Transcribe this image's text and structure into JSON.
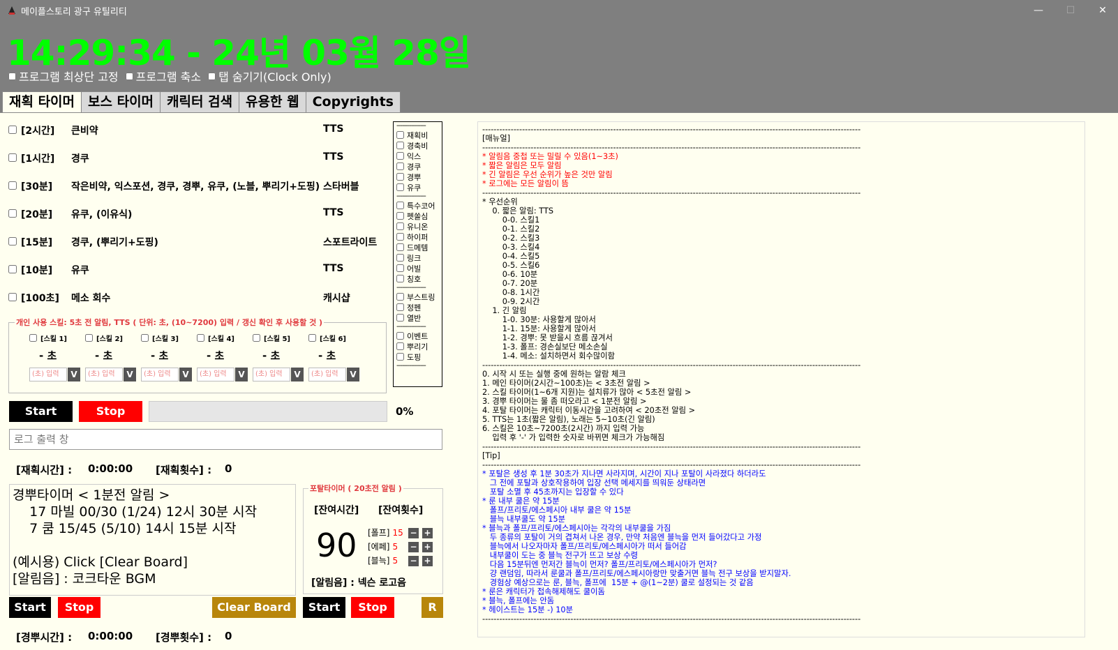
{
  "window": {
    "title": "메이플스토리 광구 유틸리티",
    "minimize": "—",
    "maximize": "☐",
    "close": "✕"
  },
  "clock": "14:29:34 - 24년 03월 28일",
  "options": [
    "프로그램 최상단 고정",
    "프로그램 축소",
    "탭 숨기기(Clock Only)"
  ],
  "tabs": [
    "재획 타이머",
    "보스 타이머",
    "캐릭터 검색",
    "유용한 웹",
    "Copyrights"
  ],
  "timers": [
    {
      "time": "[2시간]",
      "items": "큰비약",
      "sound": "TTS"
    },
    {
      "time": "[1시간]",
      "items": "경쿠",
      "sound": "TTS"
    },
    {
      "time": "[30분]",
      "items": "작은비약, 익스포션, 경쿠, 경뿌, 유쿠, (노블, 뿌리기+도핑)",
      "sound": "스타버블"
    },
    {
      "time": "[20분]",
      "items": "유쿠, (이유식)",
      "sound": "TTS"
    },
    {
      "time": "[15분]",
      "items": "경쿠, (뿌리기+도핑)",
      "sound": "스포트라이트"
    },
    {
      "time": "[10분]",
      "items": "유쿠",
      "sound": "TTS"
    },
    {
      "time": "[100초]",
      "items": "메소 회수",
      "sound": "캐시샵"
    }
  ],
  "checklist": {
    "dash": "----------------",
    "groups": [
      [
        "재획비",
        "경축비",
        "익스",
        "경쿠",
        "경뿌",
        "유쿠"
      ],
      [
        "특수코어",
        "펫쏠심",
        "유니온",
        "하이퍼",
        "드메템",
        "링크",
        "어빌",
        "칭호"
      ],
      [
        "부스트링",
        "정펜",
        "열반"
      ],
      [
        "이벤트",
        "뿌리기",
        "도핑"
      ]
    ]
  },
  "skills": {
    "legend": "개인 사용 스킬: 5초 전 알림, TTS ( 단위: 초, (10~7200) 입력 / 갱신 확인 후 사용할 것 )",
    "items": [
      {
        "label": "[스킬 1]",
        "value": "-  초",
        "placeholder": "(초) 입력",
        "button": "V"
      },
      {
        "label": "[스킬 2]",
        "value": "-  초",
        "placeholder": "(초) 입력",
        "button": "V"
      },
      {
        "label": "[스킬 3]",
        "value": "-  초",
        "placeholder": "(초) 입력",
        "button": "V"
      },
      {
        "label": "[스킬 4]",
        "value": "-  초",
        "placeholder": "(초) 입력",
        "button": "V"
      },
      {
        "label": "[스킬 5]",
        "value": "-  초",
        "placeholder": "(초) 입력",
        "button": "V"
      },
      {
        "label": "[스킬 6]",
        "value": "-  초",
        "placeholder": "(초) 입력",
        "button": "V"
      }
    ]
  },
  "controls": {
    "start": "Start",
    "stop": "Stop",
    "progress": 0,
    "percent": "0%",
    "log_placeholder": "로그 출력 창"
  },
  "stats": {
    "hunt_time_label": "[재획시간] :",
    "hunt_time": "0:00:00",
    "hunt_count_label": "[재획횟수] :",
    "hunt_count": "0",
    "gb_time_label": "[경뿌시간] :",
    "gb_time": "0:00:00",
    "gb_count_label": "[경뿌횟수] :",
    "gb_count": "0"
  },
  "board": {
    "text": "경뿌타이머 < 1분전 알림 >\n    17 마빌 00/30 (1/24) 12시 30분 시작\n    7 쿰 15/45 (5/10) 14시 15분 시작\n\n(예시용) Click [Clear Board]\n[알림음] : 코크타운 BGM",
    "start": "Start",
    "stop": "Stop",
    "clear": "Clear Board"
  },
  "portal": {
    "legend": "포탈타이머 ( 20초전 알림 )",
    "remain_time_label": "[잔여시간]",
    "remain_count_label": "[잔여횟수]",
    "time": "90",
    "counters": [
      {
        "label": "[폴프]",
        "value": "15"
      },
      {
        "label": "[에페]",
        "value": "5"
      },
      {
        "label": "[블늑]",
        "value": "5"
      }
    ],
    "minus": "−",
    "plus": "+",
    "sound": "[알림음] : 넥슨 로고음",
    "start": "Start",
    "stop": "Stop",
    "reset": "R"
  },
  "manual": [
    {
      "c": "",
      "t": "-------------------------------------------------------------------------------------------------------------------------------------"
    },
    {
      "c": "",
      "t": "[매뉴얼]"
    },
    {
      "c": "",
      "t": "-------------------------------------------------------------------------------------------------------------------------------------"
    },
    {
      "c": "red",
      "t": "* 알림음 중첩 또는 밀릴 수 있음(1~3초)"
    },
    {
      "c": "red",
      "t": "* 짧은 알림은 모두 알림"
    },
    {
      "c": "red",
      "t": "* 긴 알림은 우선 순위가 높은 것만 알림"
    },
    {
      "c": "red",
      "t": "* 로그에는 모든 알림이 뜸"
    },
    {
      "c": "",
      "t": "-------------------------------------------------------------------------------------------------------------------------------------"
    },
    {
      "c": "",
      "t": "* 우선순위"
    },
    {
      "c": "",
      "t": "    0. 짧은 알림: TTS"
    },
    {
      "c": "",
      "t": "        0-0. 스킬1"
    },
    {
      "c": "",
      "t": "        0-1. 스킬2"
    },
    {
      "c": "",
      "t": "        0-2. 스킬3"
    },
    {
      "c": "",
      "t": "        0-3. 스킬4"
    },
    {
      "c": "",
      "t": "        0-4. 스킬5"
    },
    {
      "c": "",
      "t": "        0-5. 스킬6"
    },
    {
      "c": "",
      "t": "        0-6. 10분"
    },
    {
      "c": "",
      "t": "        0-7. 20분"
    },
    {
      "c": "",
      "t": "        0-8. 1시간"
    },
    {
      "c": "",
      "t": "        0-9. 2시간"
    },
    {
      "c": "",
      "t": "    1. 긴 알림"
    },
    {
      "c": "",
      "t": "        1-0. 30분: 사용할게 많아서"
    },
    {
      "c": "",
      "t": "        1-1. 15분: 사용할게 많아서"
    },
    {
      "c": "",
      "t": "        1-2. 경뿌: 못 받을시 흐름 끊겨서"
    },
    {
      "c": "",
      "t": "        1-3. 폴프: 경손실보단 메소손실"
    },
    {
      "c": "",
      "t": "        1-4. 메소: 설치하면서 회수많이함"
    },
    {
      "c": "",
      "t": "-------------------------------------------------------------------------------------------------------------------------------------"
    },
    {
      "c": "",
      "t": "0. 시작 시 또는 실행 중에 원하는 알람 체크"
    },
    {
      "c": "",
      "t": "1. 메인 타이머(2시간~100초)는 < 3초전 알림 >"
    },
    {
      "c": "",
      "t": "2. 스킬 타이머(1~6개 지원)는 설치류가 많아 < 5초전 알림 >"
    },
    {
      "c": "",
      "t": "3. 경뿌 타이머는 물 좀 떠오라고 < 1분전 알림 >"
    },
    {
      "c": "",
      "t": "4. 포탈 타이머는 캐릭터 이동시간을 고려하여 < 20초전 알림 >"
    },
    {
      "c": "",
      "t": "5. TTS는 1초(짧은 알림), 노래는 5~10초(긴 알림)"
    },
    {
      "c": "",
      "t": "6. 스킬은 10초~7200초(2시간) 까지 입력 가능"
    },
    {
      "c": "",
      "t": "    입력 후 '-' 가 입력한 숫자로 바뀌면 체크가 가능해짐"
    },
    {
      "c": "",
      "t": "-------------------------------------------------------------------------------------------------------------------------------------"
    },
    {
      "c": "",
      "t": "[Tip]"
    },
    {
      "c": "",
      "t": "-------------------------------------------------------------------------------------------------------------------------------------"
    },
    {
      "c": "blue",
      "t": "* 포탈은 생성 후 1분 30초가 지나면 사라지며, 시간이 지나 포탈이 사라졌다 하더라도"
    },
    {
      "c": "blue",
      "t": "   그 전에 포탈과 상호작용하여 입장 선택 메세지를 띄워둔 상태라면"
    },
    {
      "c": "blue",
      "t": "   포탈 소멸 후 45초까지는 입장할 수 있다"
    },
    {
      "c": "blue",
      "t": "* 룬 내부 쿨은 약 15분"
    },
    {
      "c": "blue",
      "t": "   폴프/프리토/에스페시아 내부 쿨은 약 15분"
    },
    {
      "c": "blue",
      "t": "   블늑 내부쿨도 약 15분"
    },
    {
      "c": "blue",
      "t": "* 블늑과 폴프/프리토/에스페시아는 각각의 내부쿨을 가짐"
    },
    {
      "c": "blue",
      "t": "   두 종류의 포탈이 거의 겹쳐서 나온 경우, 만약 처음엔 블늑을 먼저 들어갔다고 가정"
    },
    {
      "c": "blue",
      "t": "   블늑에서 나오자마자 폴프/프리토/에스페시아가 떠서 들어감"
    },
    {
      "c": "blue",
      "t": "   내부쿨이 도는 중 블늑 전구가 뜨고 보상 수령"
    },
    {
      "c": "blue",
      "t": "   다음 15분뒤엔 먼저간 블늑이 먼저? 폴프/프리토/에스페시아가 먼저?"
    },
    {
      "c": "blue",
      "t": "   걍 랜덤임, 따라서 룬쿨과 폴프/프리토/에스페시아랑만 맞출거면 블늑 전구 보상을 받지말자."
    },
    {
      "c": "blue",
      "t": "   경험상 예상으로는 룬, 블늑, 폴프에  15분 + @(1~2분) 쿨로 설정되는 것 같음"
    },
    {
      "c": "blue",
      "t": "* 룬은 캐릭터가 접속해제해도 쿨이돔"
    },
    {
      "c": "blue",
      "t": "* 블늑, 폴프에는 안돔"
    },
    {
      "c": "blue",
      "t": "* 헤이스트는 15분 -) 10분"
    },
    {
      "c": "",
      "t": "-------------------------------------------------------------------------------------------------------------------------------------"
    }
  ]
}
